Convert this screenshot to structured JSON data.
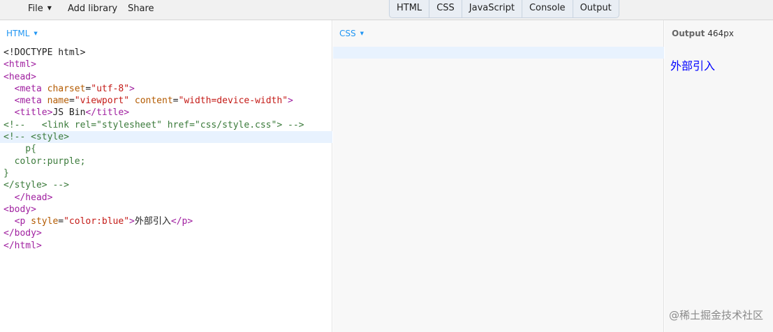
{
  "toolbar": {
    "file_label": "File",
    "add_library_label": "Add library",
    "share_label": "Share",
    "tabs": [
      "HTML",
      "CSS",
      "JavaScript",
      "Console",
      "Output"
    ]
  },
  "panels": {
    "html_label": "HTML",
    "css_label": "CSS",
    "output_label": "Output",
    "output_size": "464px"
  },
  "editor": {
    "active_line": 7,
    "lines": [
      [
        [
          "text",
          "<!DOCTYPE html>"
        ]
      ],
      [
        [
          "tag",
          "<html>"
        ]
      ],
      [
        [
          "tag",
          "<head>"
        ]
      ],
      [
        [
          "text",
          "  "
        ],
        [
          "tag",
          "<meta "
        ],
        [
          "attr",
          "charset"
        ],
        [
          "text",
          "="
        ],
        [
          "str",
          "\"utf-8\""
        ],
        [
          "tag",
          ">"
        ]
      ],
      [
        [
          "text",
          "  "
        ],
        [
          "tag",
          "<meta "
        ],
        [
          "attr",
          "name"
        ],
        [
          "text",
          "="
        ],
        [
          "str",
          "\"viewport\""
        ],
        [
          "text",
          " "
        ],
        [
          "attr",
          "content"
        ],
        [
          "text",
          "="
        ],
        [
          "str",
          "\"width=device-width\""
        ],
        [
          "tag",
          ">"
        ]
      ],
      [
        [
          "text",
          "  "
        ],
        [
          "tag",
          "<title>"
        ],
        [
          "text",
          "JS Bin"
        ],
        [
          "tag",
          "</title>"
        ]
      ],
      [
        [
          "comment",
          "<!--   <link rel=\"stylesheet\" href=\"css/style.css\"> -->"
        ]
      ],
      [
        [
          "comment",
          "<!-- <style>"
        ]
      ],
      [
        [
          "comment",
          "    p{"
        ]
      ],
      [
        [
          "comment",
          "  color:purple;"
        ]
      ],
      [
        [
          "comment",
          "}"
        ]
      ],
      [
        [
          "comment",
          "</style> -->"
        ]
      ],
      [
        [
          "text",
          "  "
        ],
        [
          "tag",
          "</head>"
        ]
      ],
      [
        [
          "tag",
          "<body>"
        ]
      ],
      [
        [
          "text",
          "  "
        ],
        [
          "tag",
          "<p "
        ],
        [
          "attr",
          "style"
        ],
        [
          "text",
          "="
        ],
        [
          "str",
          "\"color:blue\""
        ],
        [
          "tag",
          ">"
        ],
        [
          "text",
          "外部引入"
        ],
        [
          "tag",
          "</p>"
        ]
      ],
      [
        [
          "tag",
          "</body>"
        ]
      ],
      [
        [
          "tag",
          "</html>"
        ]
      ]
    ]
  },
  "output": {
    "text": "外部引入",
    "text_color": "#0000ff"
  },
  "watermark": "@稀土掘金技术社区",
  "colors": {
    "accent": "#2196f3",
    "tag": "#a020a0",
    "attr": "#b35a00",
    "string": "#c41a16",
    "comment": "#3a7a3a",
    "active_line": "#e8f2fe"
  }
}
